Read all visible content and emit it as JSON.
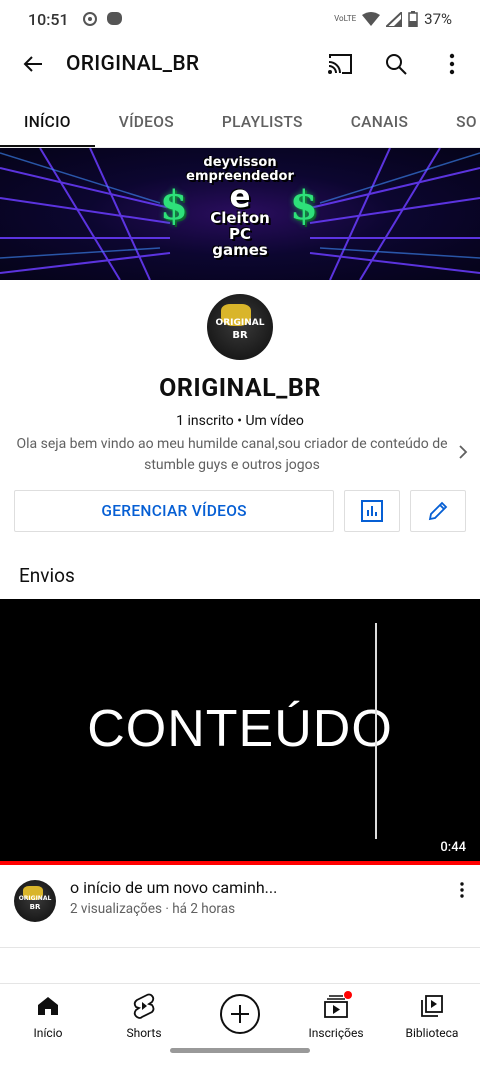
{
  "status_bar": {
    "time": "10:51",
    "network": "VoLTE",
    "battery": "37%"
  },
  "app_bar": {
    "title": "ORIGINAL_BR"
  },
  "tabs": [
    {
      "label": "INÍCIO",
      "active": true
    },
    {
      "label": "VÍDEOS",
      "active": false
    },
    {
      "label": "PLAYLISTS",
      "active": false
    },
    {
      "label": "CANAIS",
      "active": false
    },
    {
      "label": "SO",
      "active": false
    }
  ],
  "banner": {
    "line1": "deyvisson",
    "line2": "empreendedor",
    "line3": "e",
    "line4": "Cleiton",
    "line5": "PC",
    "line6": "games",
    "symbol": "$"
  },
  "avatar": {
    "line1": "ORIGINAL",
    "line2": "BR"
  },
  "channel": {
    "name": "ORIGINAL_BR",
    "subscribers": "1 inscrito",
    "separator": " • ",
    "video_count": "Um vídeo",
    "description": "Ola seja bem vindo ao meu humilde canal,sou criador de conteúdo de stumble guys e outros jogos"
  },
  "actions": {
    "manage_label": "GERENCIAR VÍDEOS"
  },
  "uploads": {
    "section_title": "Envios",
    "thumbnail_text": "CONTEÚDO",
    "duration": "0:44",
    "video_title": "o início de um novo caminh...",
    "video_meta": "2 visualizações · há 2 horas"
  },
  "bottom_nav": [
    {
      "label": "Início",
      "icon": "home-icon"
    },
    {
      "label": "Shorts",
      "icon": "shorts-icon"
    },
    {
      "label": "",
      "icon": "create-icon"
    },
    {
      "label": "Inscrições",
      "icon": "subscriptions-icon"
    },
    {
      "label": "Biblioteca",
      "icon": "library-icon"
    }
  ],
  "colors": {
    "accent_blue": "#065fd4",
    "progress_red": "#ff0000",
    "text_primary": "#0f0f0f",
    "text_secondary": "#606060"
  }
}
